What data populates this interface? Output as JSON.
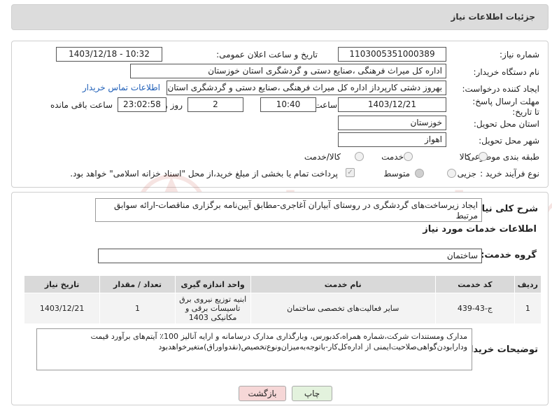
{
  "header": {
    "title": "جزئیات اطلاعات نیاز"
  },
  "form": {
    "need_number_label": "شماره نیاز:",
    "need_number": "1103005351000389",
    "announce_label": "تاریخ و ساعت اعلان عمومی:",
    "announce_value": "1403/12/18 - 10:32",
    "buyer_org_label": "نام دستگاه خریدار:",
    "buyer_org": "اداره کل میراث فرهنگی ،صنایع دستی و گردشگری استان خوزستان",
    "creator_label": "ایجاد کننده درخواست:",
    "creator": "بهروز دشتی کارپرداز اداره کل میراث فرهنگی ،صنایع دستی و گردشگری استان خوزستان",
    "contact_link": "اطلاعات تماس خریدار",
    "deadline_label": "مهلت ارسال پاسخ: تا تاریخ:",
    "deadline_date": "1403/12/21",
    "time_label": "ساعت",
    "deadline_time": "10:40",
    "days_value": "2",
    "days_label": "روز و",
    "remaining_time": "23:02:58",
    "remaining_label": "ساعت باقی مانده",
    "province_label": "استان محل تحویل:",
    "province": "خوزستان",
    "city_label": "شهر محل تحویل:",
    "city": "اهواز",
    "category_label": "طبقه بندی موضوعی:",
    "category_options": [
      "کالا",
      "خدمت",
      "کالا/خدمت"
    ],
    "process_label": "نوع فرآیند خرید :",
    "process_options": [
      "جزیی",
      "متوسط"
    ],
    "payment_note": "پرداخت تمام یا بخشی از مبلغ خرید،از محل \"اسناد خزانه اسلامی\" خواهد بود."
  },
  "description": {
    "label": "شرح کلی نیاز:",
    "text": "ایجاد زیرساخت‌های گردشگری در روستای آبیاران آغاجری-مطابق آیین‌نامه برگزاری مناقصات-ارائه سوابق مرتبط"
  },
  "services": {
    "section_title": "اطلاعات خدمات مورد نیاز",
    "group_label": "گروه خدمت:",
    "group_value": "ساختمان",
    "columns": [
      "ردیف",
      "کد خدمت",
      "نام خدمت",
      "واحد اندازه گیری",
      "تعداد / مقدار",
      "تاریخ نیاز"
    ],
    "rows": [
      {
        "index": "1",
        "code": "ج-43-439",
        "name": "سایر فعالیت‌های تخصصی ساختمان",
        "unit": "ابنیه توزیع نیروی برق تاسیسات برقی و مکانیکی 1403",
        "qty": "1",
        "date": "1403/12/21"
      }
    ]
  },
  "buyer_notes": {
    "label": "توضیحات خریدار:",
    "text": "مدارک ومستندات شرکت،شماره همراه،کدبورس، وبارگذاری مدارک درسامانه و ارایه آنالیز 100٪ آیتم‌های برآورد قیمت ودارابودن‌گواهی‌صلاحیت‌ایمنی از اداره‌کل‌کار-باتوجه‌به‌میزان‌ونوع‌تخصیص(نقدواوراق)متغیرخواهدبود"
  },
  "buttons": {
    "print": "چاپ",
    "back": "بازگشت"
  },
  "watermark": {
    "text": "AriaTender.neT"
  },
  "colors": {
    "link": "#1f5fb8",
    "header_bg": "#dcdcdc",
    "back_button_bg": "#f6d7d7",
    "print_button_bg": "#e3f2dd"
  }
}
